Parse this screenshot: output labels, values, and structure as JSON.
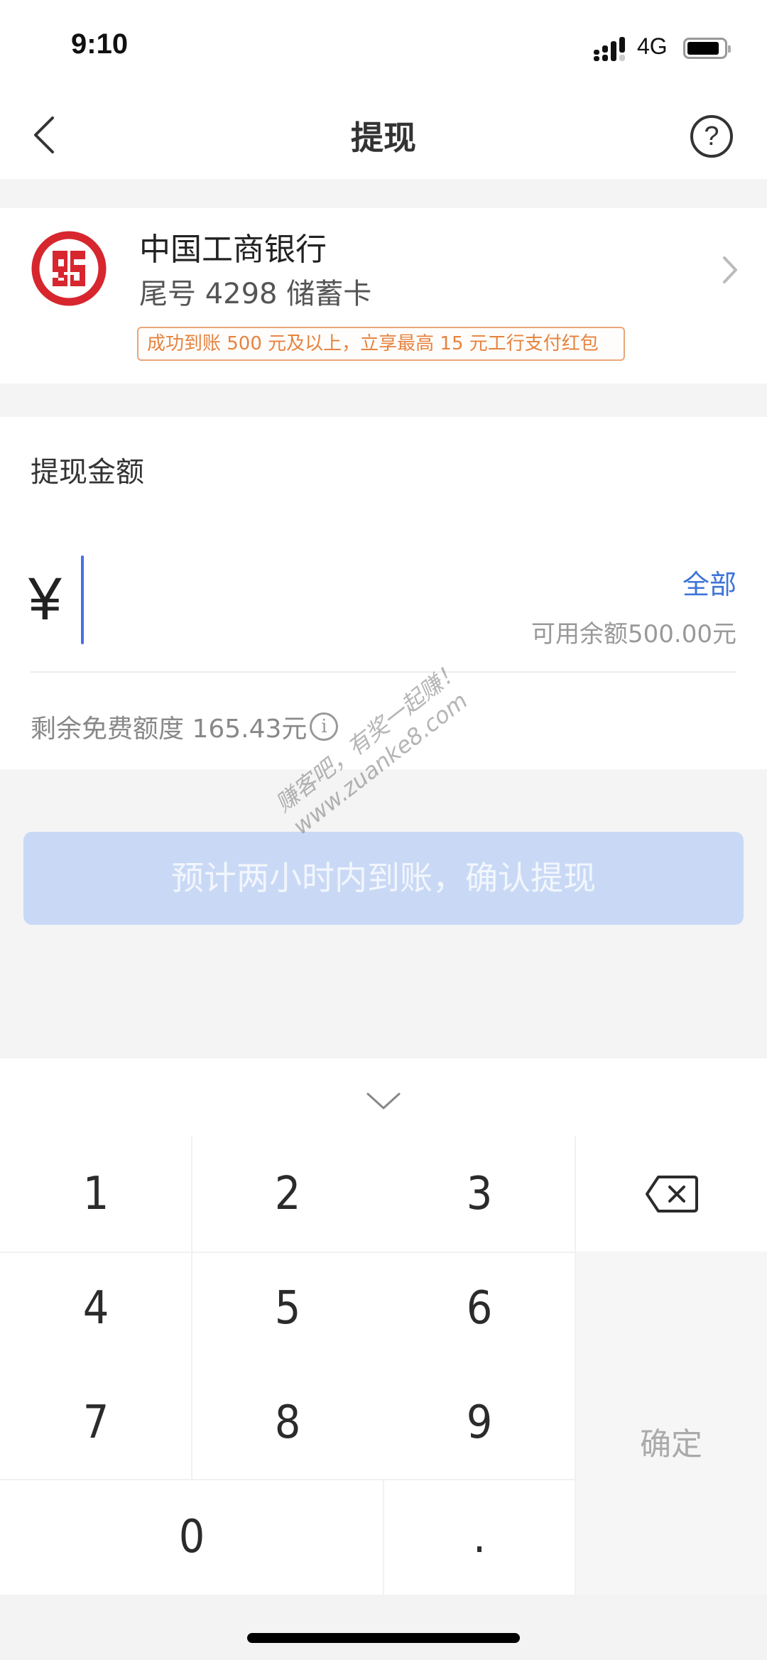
{
  "status_bar": {
    "time": "9:10",
    "network": "4G",
    "battery_level": 0.85
  },
  "nav": {
    "title": "提现",
    "back_icon": "chevron-left-icon",
    "help_icon": "question-circle-icon",
    "help_glyph": "?"
  },
  "bank_card": {
    "bank_name": "中国工商银行",
    "card_info": "尾号 4298 储蓄卡",
    "promo": "成功到账 500 元及以上，立享最高 15 元工行支付红包",
    "logo_color": "#d7262e",
    "promo_color": "#e5833f"
  },
  "amount": {
    "label": "提现金额",
    "currency_symbol": "¥",
    "value": "",
    "all_label": "全部",
    "available": "可用余额500.00元",
    "free_quota": "剩余免费额度 165.43元",
    "info_glyph": "i",
    "accent_color": "#3d74d8"
  },
  "submit_button": {
    "label": "预计两小时内到账，确认提现",
    "enabled": false,
    "color": "#c9d9f5"
  },
  "watermark": {
    "line1": "赚客吧，有奖一起赚！",
    "line2": "www.zuanke8.com"
  },
  "keypad": {
    "keys": [
      "1",
      "2",
      "3",
      "4",
      "5",
      "6",
      "7",
      "8",
      "9",
      "0",
      "."
    ],
    "confirm_label": "确定",
    "backspace_icon": "backspace-icon",
    "collapse_icon": "chevron-down-icon"
  }
}
